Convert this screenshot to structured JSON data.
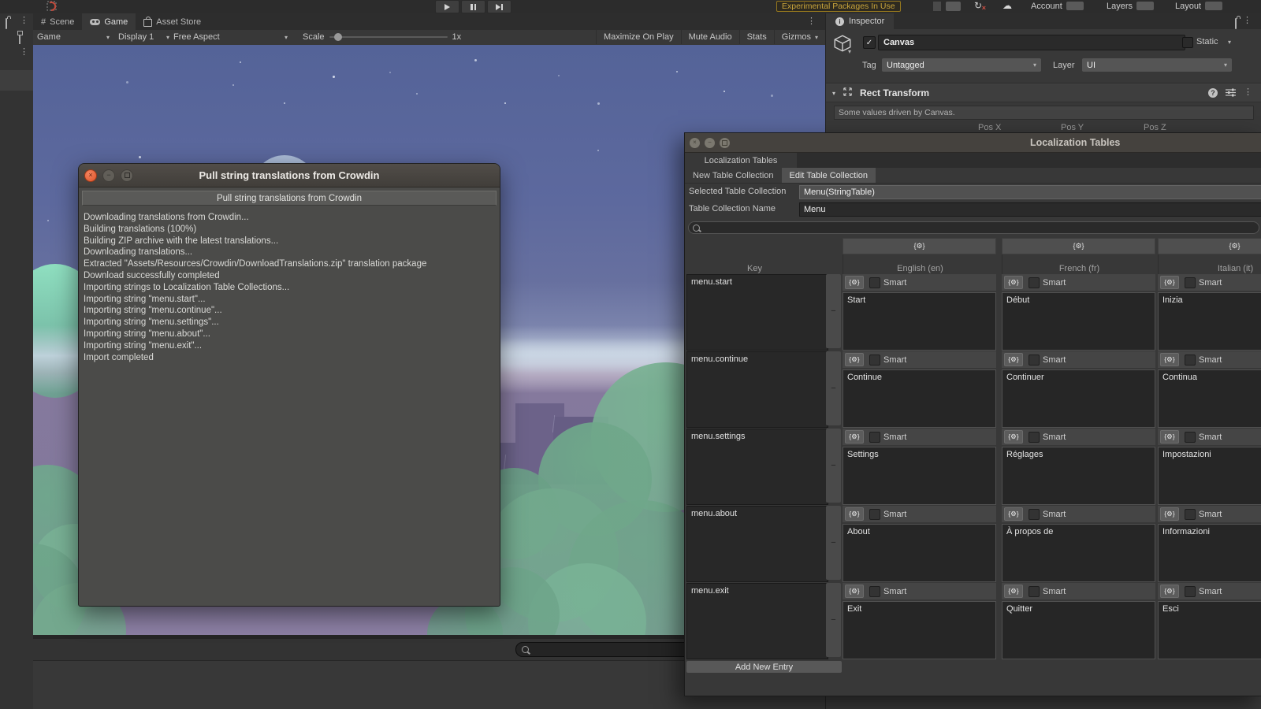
{
  "topbar": {
    "experimental_warning": "Experimental Packages In Use",
    "account": "Account",
    "layers": "Layers",
    "layout": "Layout"
  },
  "tabs": {
    "scene": "Scene",
    "game": "Game",
    "asset_store": "Asset Store"
  },
  "game_toolbar": {
    "display_target": "Game",
    "display": "Display 1",
    "aspect": "Free Aspect",
    "scale_label": "Scale",
    "scale_value": "1x",
    "maximize_on_play": "Maximize On Play",
    "mute_audio": "Mute Audio",
    "stats": "Stats",
    "gizmos": "Gizmos"
  },
  "inspector": {
    "tab": "Inspector",
    "object_name": "Canvas",
    "static_label": "Static",
    "tag_label": "Tag",
    "tag_value": "Untagged",
    "layer_label": "Layer",
    "layer_value": "UI",
    "component_name": "Rect Transform",
    "info_message": "Some values driven by Canvas.",
    "pos_labels": [
      "Pos X",
      "Pos Y",
      "Pos Z"
    ]
  },
  "crowdin_dialog": {
    "window_title": "Pull string translations from Crowdin",
    "header_button": "Pull string translations from Crowdin",
    "log_lines": [
      "Downloading translations from Crowdin...",
      "Building translations (100%)",
      "Building ZIP archive with the latest translations...",
      "Downloading translations...",
      "Extracted \"Assets/Resources/Crowdin/DownloadTranslations.zip\" translation package",
      "Download successfully completed",
      "Importing strings to Localization Table Collections...",
      "Importing string \"menu.start\"...",
      "Importing string \"menu.continue\"...",
      "Importing string \"menu.settings\"...",
      "Importing string \"menu.about\"...",
      "Importing string \"menu.exit\"...",
      "Import completed"
    ]
  },
  "localization_window": {
    "window_title": "Localization Tables",
    "tab": "Localization Tables",
    "new_table_collection": "New Table Collection",
    "edit_table_collection": "Edit Table Collection",
    "selected_table_collection_label": "Selected Table Collection",
    "selected_table_collection_value": "Menu(StringTable)",
    "table_collection_name_label": "Table Collection Name",
    "table_collection_name_value": "Menu",
    "key_header": "Key",
    "columns": [
      "English (en)",
      "French (fr)",
      "Italian (it)"
    ],
    "smart_label": "Smart",
    "remove_entry_label": "−",
    "add_new_entry": "Add New Entry",
    "rows": [
      {
        "key": "menu.start",
        "values": [
          "Start",
          "Début",
          "Inizia"
        ]
      },
      {
        "key": "menu.continue",
        "values": [
          "Continue",
          "Continuer",
          "Continua"
        ]
      },
      {
        "key": "menu.settings",
        "values": [
          "Settings",
          "Réglages",
          "Impostazioni"
        ]
      },
      {
        "key": "menu.about",
        "values": [
          "About",
          "À propos de",
          "Informazioni"
        ]
      },
      {
        "key": "menu.exit",
        "values": [
          "Exit",
          "Quitter",
          "Esci"
        ]
      }
    ]
  },
  "icons": {
    "kebab": "⋮",
    "caret": "▾",
    "cloud": "☁",
    "refresh": "↻",
    "gear_braces": "{⚙}",
    "check": "✓",
    "scene_hash": "#",
    "info": "i",
    "help": "?",
    "window_close": "×",
    "window_min": "−"
  },
  "colors": {
    "experimental_text": "#c9a53b",
    "dialog_close_button": "#e0552b",
    "sky_top": "#546398",
    "ground_purple": "#85799d",
    "bush_green": "#74ab8e",
    "panel_grey": "#383838"
  }
}
